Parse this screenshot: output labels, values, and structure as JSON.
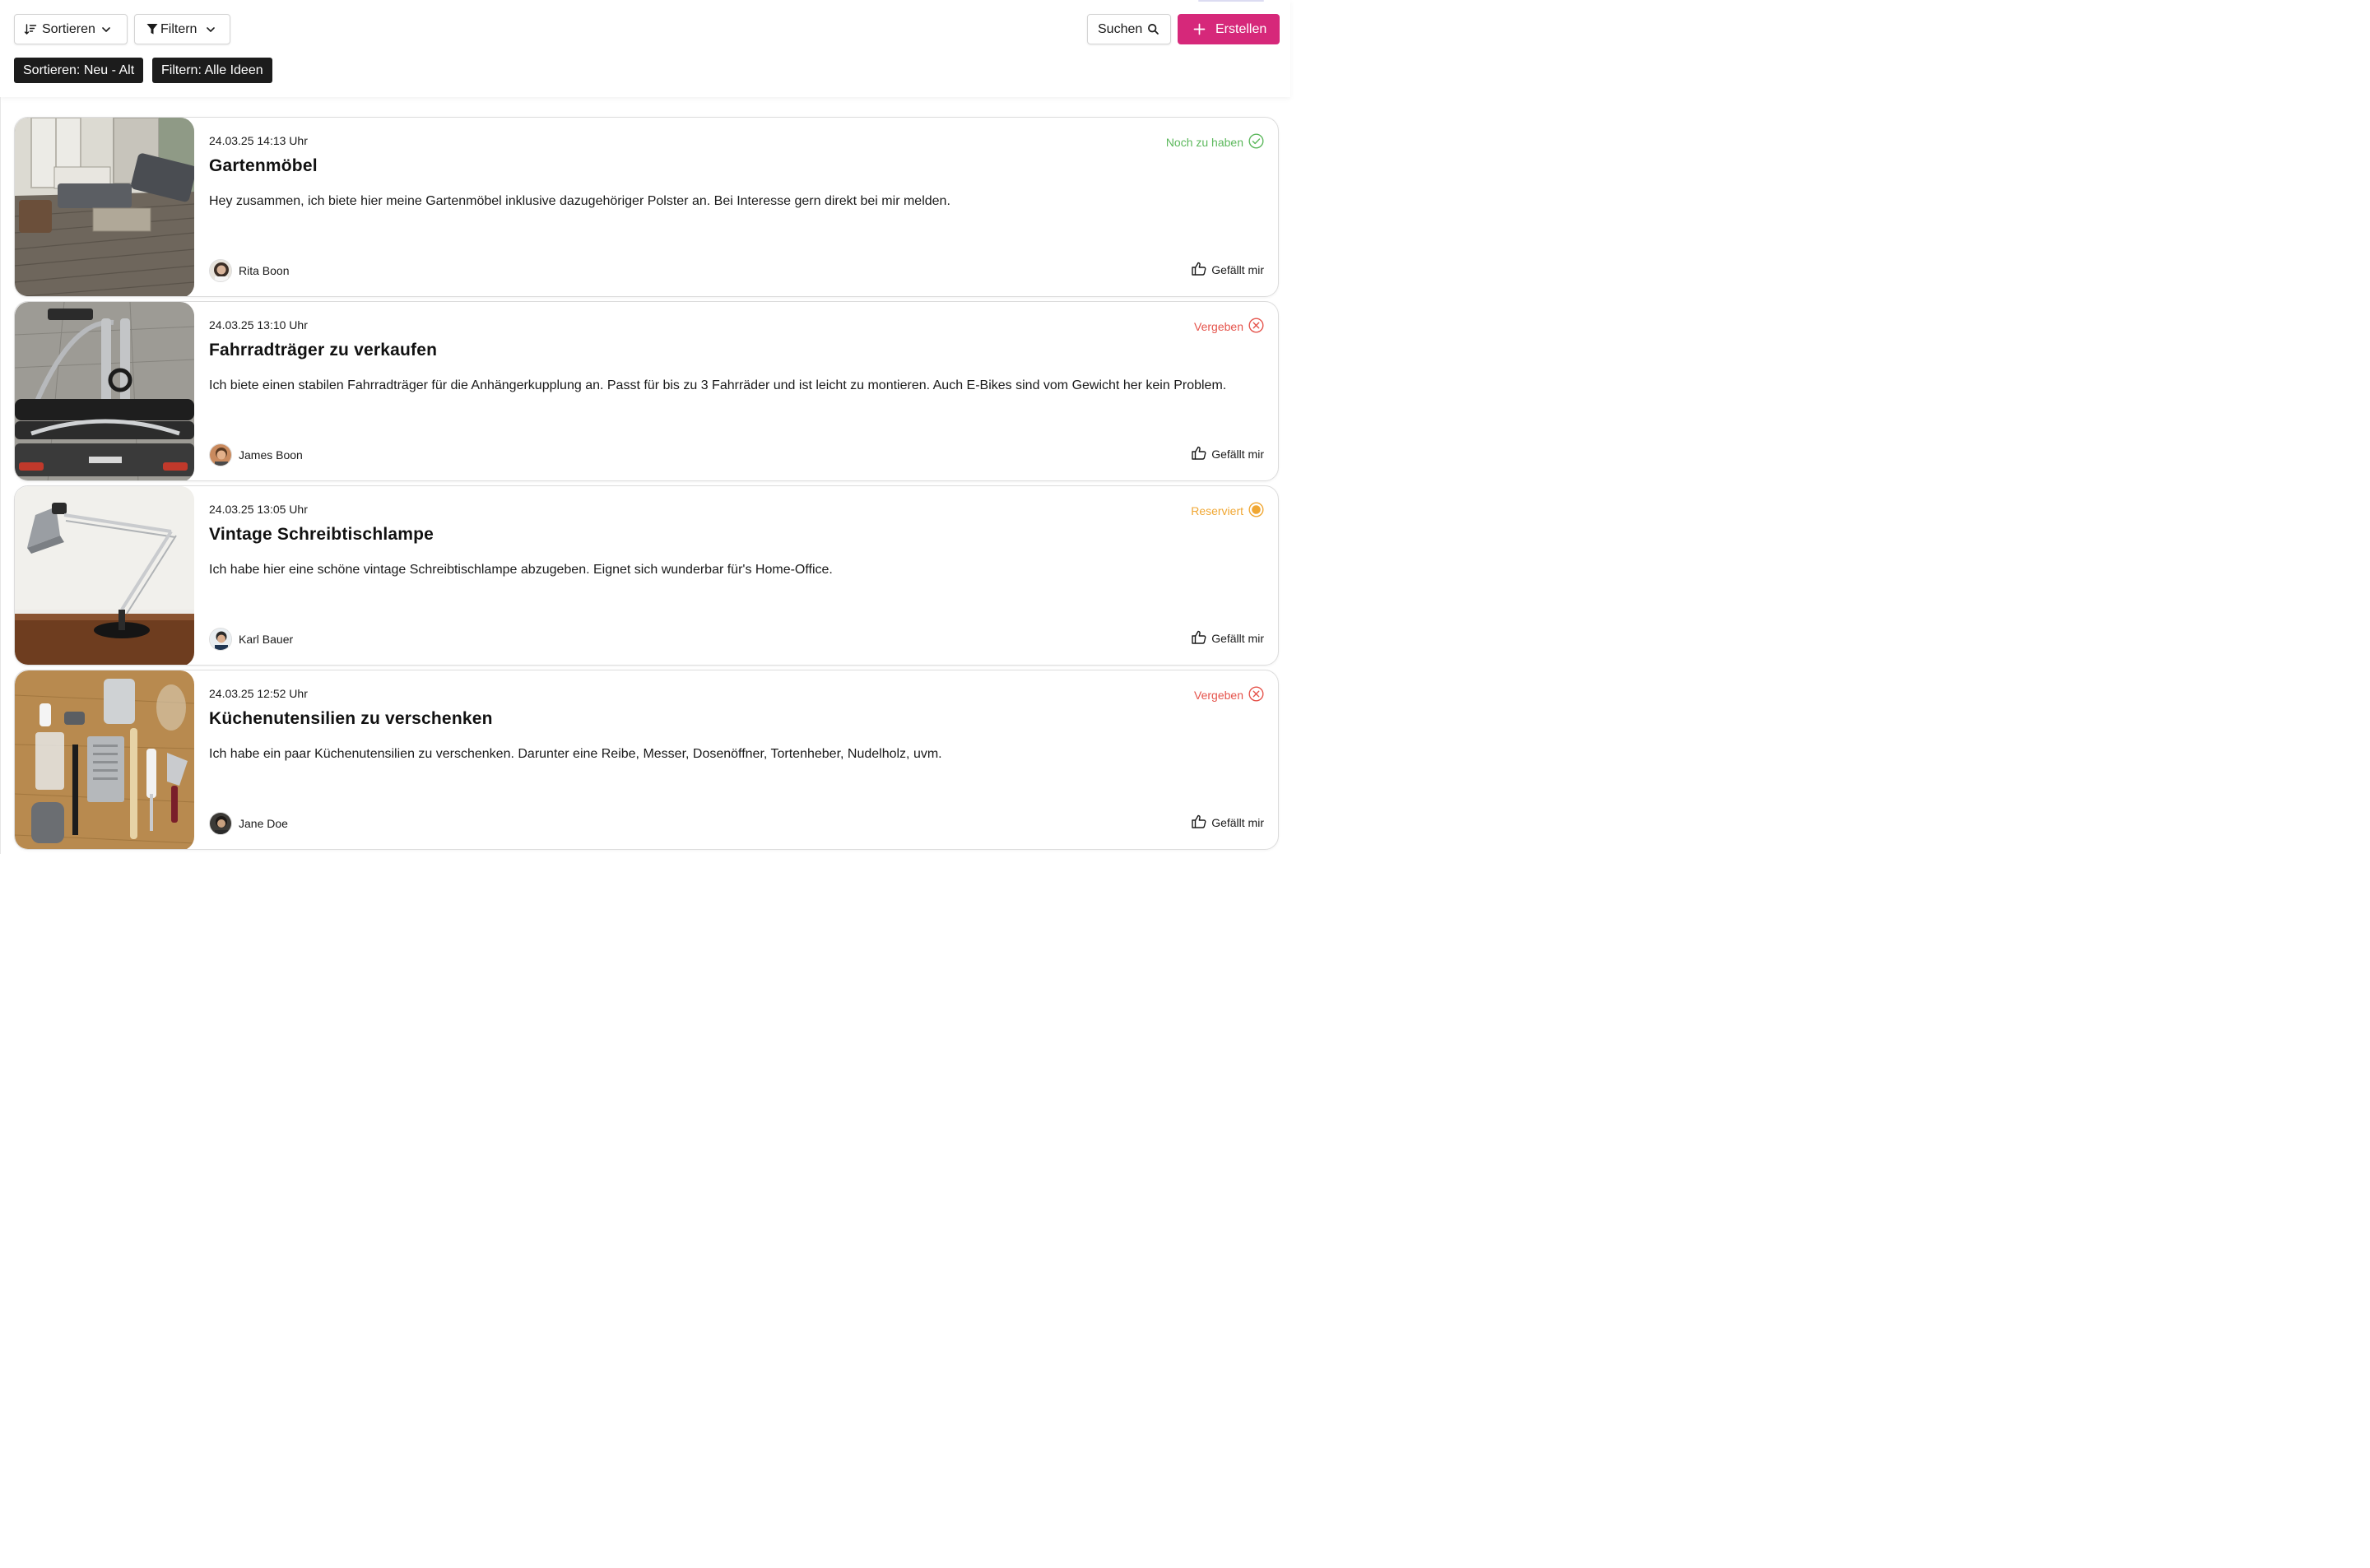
{
  "toolbar": {
    "sort_label": "Sortieren",
    "filter_label": "Filtern",
    "search_label": "Suchen",
    "create_label": "Erstellen",
    "create_color": "#d6287a"
  },
  "chips": {
    "sort": "Sortieren: Neu - Alt",
    "filter": "Filtern: Alle Ideen"
  },
  "status_colors": {
    "available": "#5cb85c",
    "taken": "#e5534b",
    "reserved": "#f0a733"
  },
  "cards": [
    {
      "date": "24.03.25 14:13 Uhr",
      "title": "Gartenmöbel",
      "description": "Hey zusammen, ich biete hier meine Gartenmöbel inklusive dazugehöriger Polster an. Bei Interesse gern direkt bei mir melden.",
      "author": "Rita Boon",
      "status": "Noch zu haben",
      "status_icon": "check-circle-icon",
      "like_label": "Gefällt mir"
    },
    {
      "date": "24.03.25 13:10 Uhr",
      "title": "Fahrradträger zu verkaufen",
      "description": "Ich biete einen stabilen Fahrradträger für die Anhängerkupplung an. Passt für bis zu 3 Fahrräder und ist leicht zu montieren. Auch E-Bikes sind vom Gewicht her kein Problem.",
      "author": "James Boon",
      "status": "Vergeben",
      "status_icon": "x-circle-icon",
      "like_label": "Gefällt mir"
    },
    {
      "date": "24.03.25 13:05 Uhr",
      "title": "Vintage Schreibtischlampe",
      "description": "Ich habe hier eine schöne vintage Schreibtischlampe abzugeben. Eignet sich wunderbar für's Home-Office.",
      "author": "Karl Bauer",
      "status": "Reserviert",
      "status_icon": "dot-circle-icon",
      "like_label": "Gefällt mir"
    },
    {
      "date": "24.03.25 12:52 Uhr",
      "title": "Küchenutensilien zu verschenken",
      "description": "Ich habe ein paar Küchenutensilien zu verschenken. Darunter eine Reibe, Messer, Dosenöffner, Tortenheber, Nudelholz, uvm.",
      "author": "Jane Doe",
      "status": "Vergeben",
      "status_icon": "x-circle-icon",
      "like_label": "Gefällt mir"
    }
  ]
}
